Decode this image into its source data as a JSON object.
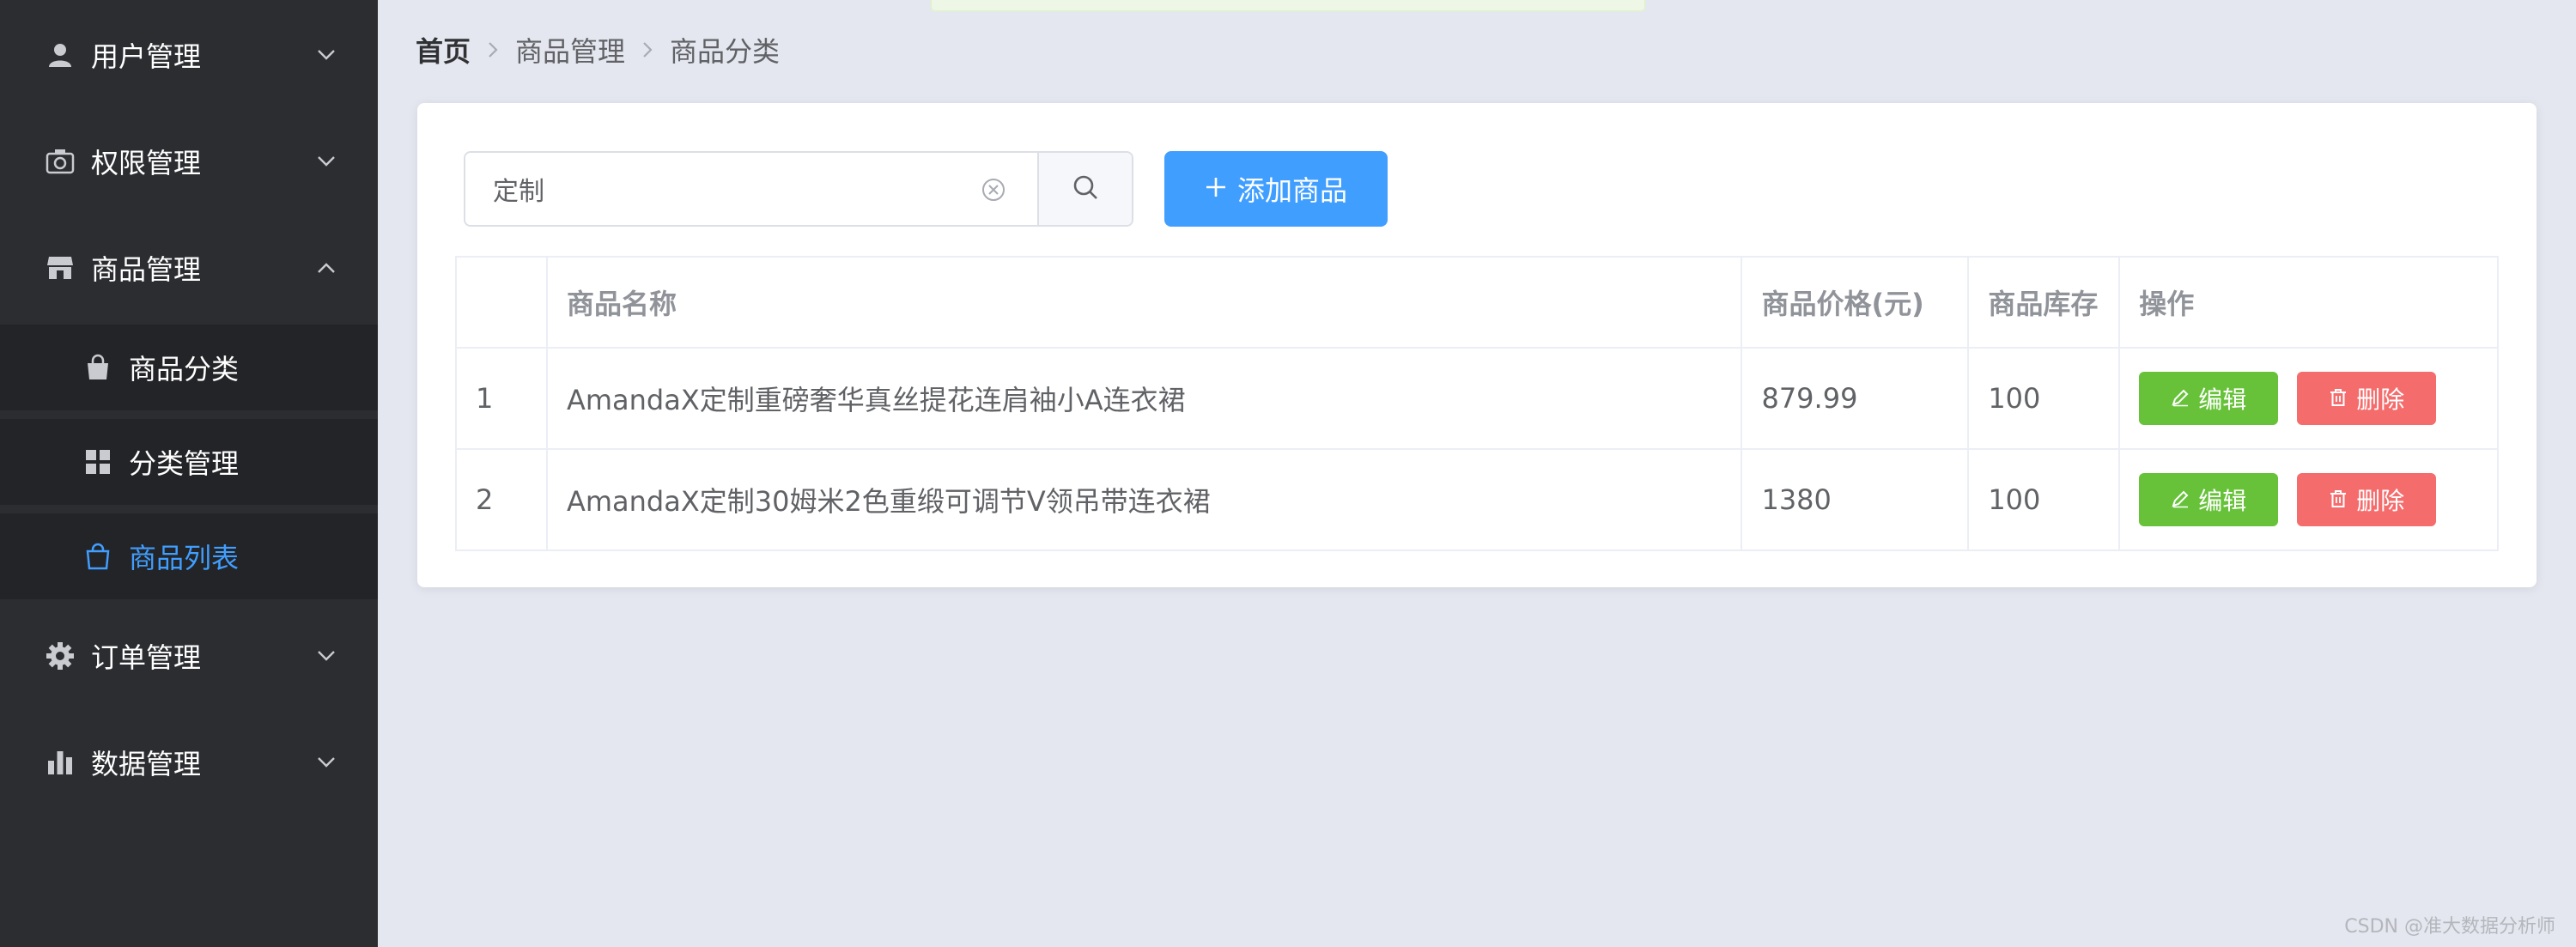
{
  "sidebar": {
    "menus": [
      {
        "label": "用户管理",
        "icon": "user-icon"
      },
      {
        "label": "权限管理",
        "icon": "camera-icon"
      },
      {
        "label": "商品管理",
        "icon": "shop-icon"
      },
      {
        "label": "订单管理",
        "icon": "gear-icon"
      },
      {
        "label": "数据管理",
        "icon": "bar-chart-icon"
      }
    ],
    "submenu": [
      {
        "label": "商品分类",
        "icon": "shopping-bag-icon"
      },
      {
        "label": "分类管理",
        "icon": "grid-icon"
      },
      {
        "label": "商品列表",
        "icon": "bag-outline-icon"
      }
    ]
  },
  "breadcrumb": {
    "items": [
      "首页",
      "商品管理",
      "商品分类"
    ]
  },
  "search": {
    "value": "定制"
  },
  "toolbar": {
    "add_label": "添加商品"
  },
  "table": {
    "headers": [
      "",
      "商品名称",
      "商品价格(元)",
      "商品库存",
      "操作"
    ],
    "rows": [
      {
        "index": "1",
        "name": "AmandaX定制重磅奢华真丝提花连肩袖小A连衣裙",
        "price": "879.99",
        "stock": "100"
      },
      {
        "index": "2",
        "name": "AmandaX定制30姆米2色重缎可调节V领吊带连衣裙",
        "price": "1380",
        "stock": "100"
      }
    ],
    "edit_label": "编辑",
    "delete_label": "删除"
  },
  "watermark": "CSDN @准大数据分析师",
  "colors": {
    "sidebar_bg": "#2b2d31",
    "active": "#409eff",
    "edit": "#67c23a",
    "delete": "#f56c6c"
  }
}
